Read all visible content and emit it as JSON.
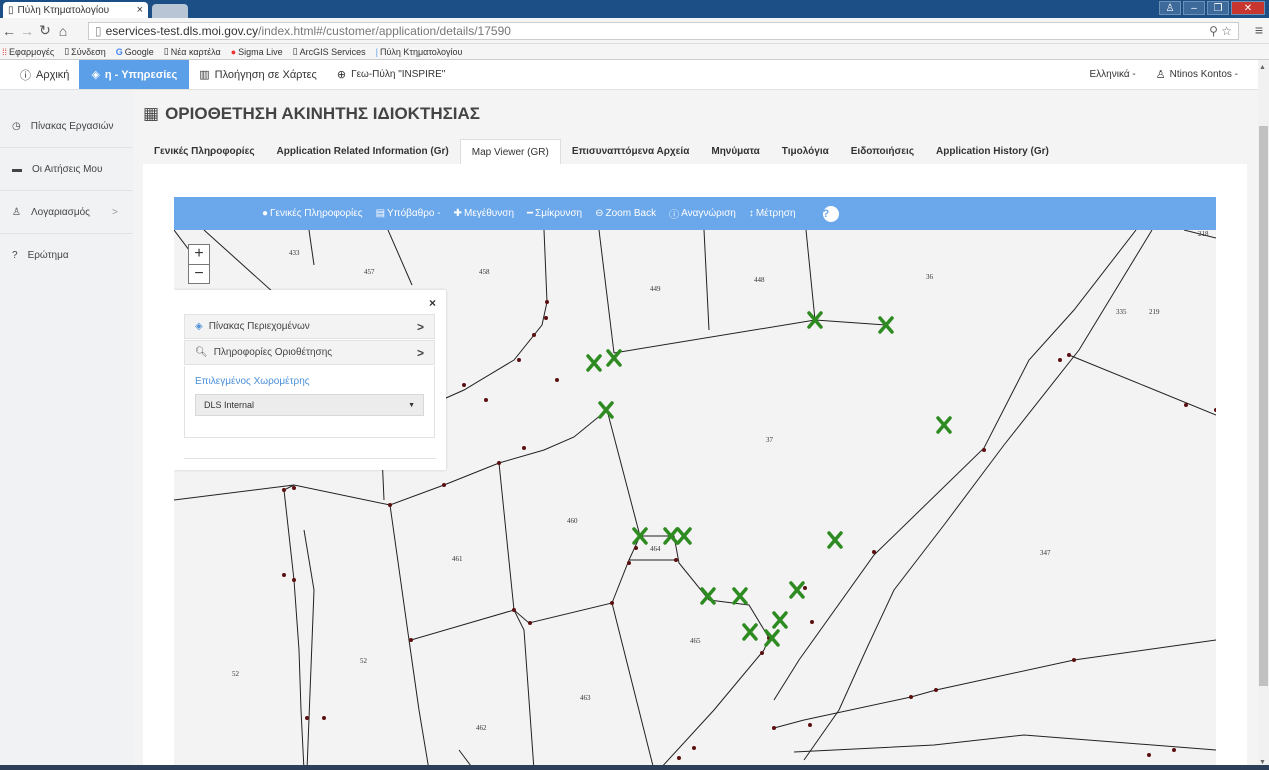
{
  "browser": {
    "tab_title": "Πύλη Κτηματολογίου",
    "tab_close": "×",
    "url_host": "eservices-test.dls.moi.gov.cy",
    "url_path": "/index.html#/customer/application/details/17590",
    "bookmarks": [
      "Εφαρμογές",
      "Σύνδεση",
      "Google",
      "Νέα καρτέλα",
      "Sigma Live",
      "ArcGIS Services",
      "Πύλη Κτηματολογίου"
    ]
  },
  "nav": {
    "home": "Αρχική",
    "services": "η - Υπηρεσίες",
    "map_nav": "Πλοήγηση σε Χάρτες",
    "geo_portal": "Γεω-Πύλη \"INSPIRE\"",
    "language": "Ελληνικά -",
    "user": "Ntinos Kontos -"
  },
  "sidebar": {
    "items": [
      {
        "label": "Πίνακας Εργασιών"
      },
      {
        "label": "Οι Αιτήσεις Μου"
      },
      {
        "label": "Λογαριασμός",
        "chevron": ">"
      },
      {
        "label": "Ερώτημα"
      }
    ]
  },
  "page": {
    "title": "ΟΡΙΟΘΕΤΗΣΗ ΑΚΙΝΗΤΗΣ ΙΔΙΟΚΤΗΣΙΑΣ",
    "tabs": [
      "Γενικές Πληροφορίες",
      "Application Related Information (Gr)",
      "Map Viewer (GR)",
      "Επισυναπτόμενα Αρχεία",
      "Μηνύματα",
      "Τιμολόγια",
      "Ειδοποιήσεις",
      "Application History (Gr)"
    ],
    "active_tab": 2
  },
  "map_toolbar": {
    "info": "Γενικές Πληροφορίες",
    "basemap": "Υπόβαθρο -",
    "zoom_in": "Μεγέθυνση",
    "zoom_out": "Σμίκρυνση",
    "zoom_back": "Zoom Back",
    "identify": "Αναγνώριση",
    "measure": "Μέτρηση",
    "help": "?"
  },
  "map": {
    "zoom_plus": "+",
    "zoom_minus": "−",
    "parcel_labels": [
      "433",
      "457",
      "458",
      "449",
      "448",
      "36",
      "218",
      "335",
      "219",
      "37",
      "460",
      "464",
      "461",
      "347",
      "465",
      "52",
      "52",
      "463",
      "462"
    ]
  },
  "info_panel": {
    "close": "×",
    "toc": "Πίνακας Περιεχομένων",
    "delineation_info": "Πληροφορίες Οριοθέτησης",
    "surveyor_label": "Επιλεγμένος Χωρομέτρης",
    "surveyor_value": "DLS Internal",
    "arrow": ">"
  },
  "colors": {
    "accent": "#5b9fe8",
    "toolbar": "#6ba7eb",
    "marker": "#2e8b22",
    "vertex": "#5a1010"
  }
}
